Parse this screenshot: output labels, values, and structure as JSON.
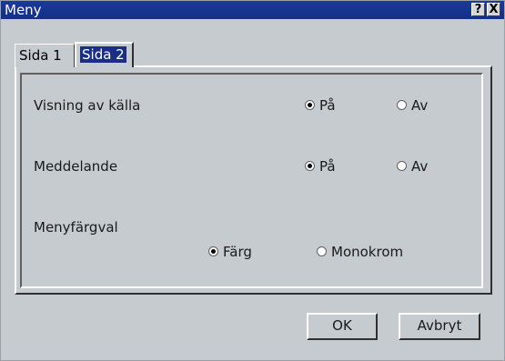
{
  "window": {
    "title": "Meny",
    "help_glyph": "?",
    "close_glyph": "X"
  },
  "tabs": [
    {
      "label": "Sida 1",
      "selected": false
    },
    {
      "label": "Sida 2",
      "selected": true
    }
  ],
  "settings": {
    "source_display": {
      "label": "Visning av källa",
      "options": [
        {
          "label": "På",
          "selected": true
        },
        {
          "label": "Av",
          "selected": false
        }
      ]
    },
    "message": {
      "label": "Meddelande",
      "options": [
        {
          "label": "På",
          "selected": true
        },
        {
          "label": "Av",
          "selected": false
        }
      ]
    },
    "menu_color": {
      "label": "Menyfärgval",
      "options": [
        {
          "label": "Färg",
          "selected": true
        },
        {
          "label": "Monokrom",
          "selected": false
        }
      ]
    }
  },
  "buttons": {
    "ok": "OK",
    "cancel": "Avbryt"
  },
  "colors": {
    "titlebar": "#1a3a9a",
    "selected_tab": "#1a2e86",
    "dialog_bg": "#c6cbd0"
  }
}
